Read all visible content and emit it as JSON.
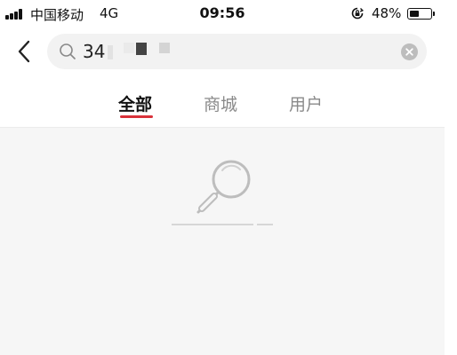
{
  "status_bar": {
    "carrier": "中国移动",
    "network": "4G",
    "time": "09:56",
    "battery_percent": "48%",
    "battery_level": 0.48
  },
  "search": {
    "query": "34"
  },
  "tabs": [
    {
      "label": "全部",
      "active": true
    },
    {
      "label": "商城",
      "active": false
    },
    {
      "label": "用户",
      "active": false
    }
  ],
  "colors": {
    "accent": "#d9323a",
    "search_bg": "#f2f2f2",
    "content_bg": "#f6f6f6"
  },
  "icons": {
    "back": "chevron-left-icon",
    "search": "search-icon",
    "clear": "clear-icon",
    "empty_state": "magnifier-empty-icon"
  }
}
